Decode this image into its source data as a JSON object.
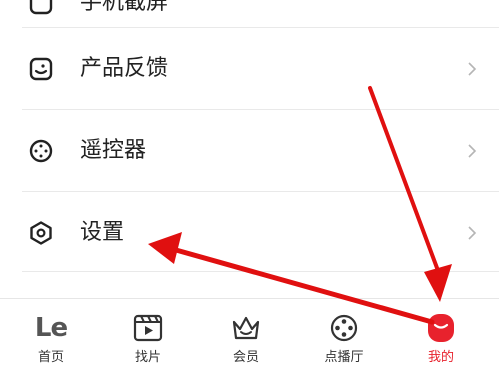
{
  "menu": {
    "top_partial_label": "手机截屏",
    "items": [
      {
        "label": "产品反馈",
        "icon": "feedback-icon"
      },
      {
        "label": "遥控器",
        "icon": "remote-control-icon"
      },
      {
        "label": "设置",
        "icon": "settings-hexagon-icon"
      }
    ]
  },
  "tabbar": {
    "items": [
      {
        "label": "首页",
        "icon": "le-logo-icon",
        "logo_text": "Le"
      },
      {
        "label": "找片",
        "icon": "clapperboard-icon"
      },
      {
        "label": "会员",
        "icon": "crown-icon"
      },
      {
        "label": "点播厅",
        "icon": "film-reel-icon"
      },
      {
        "label": "我的",
        "icon": "profile-avatar-icon",
        "active": true
      }
    ]
  },
  "colors": {
    "accent": "#e8222d",
    "annotation_arrow": "#e01010",
    "text": "#222222",
    "divider": "#e9e9e9"
  }
}
